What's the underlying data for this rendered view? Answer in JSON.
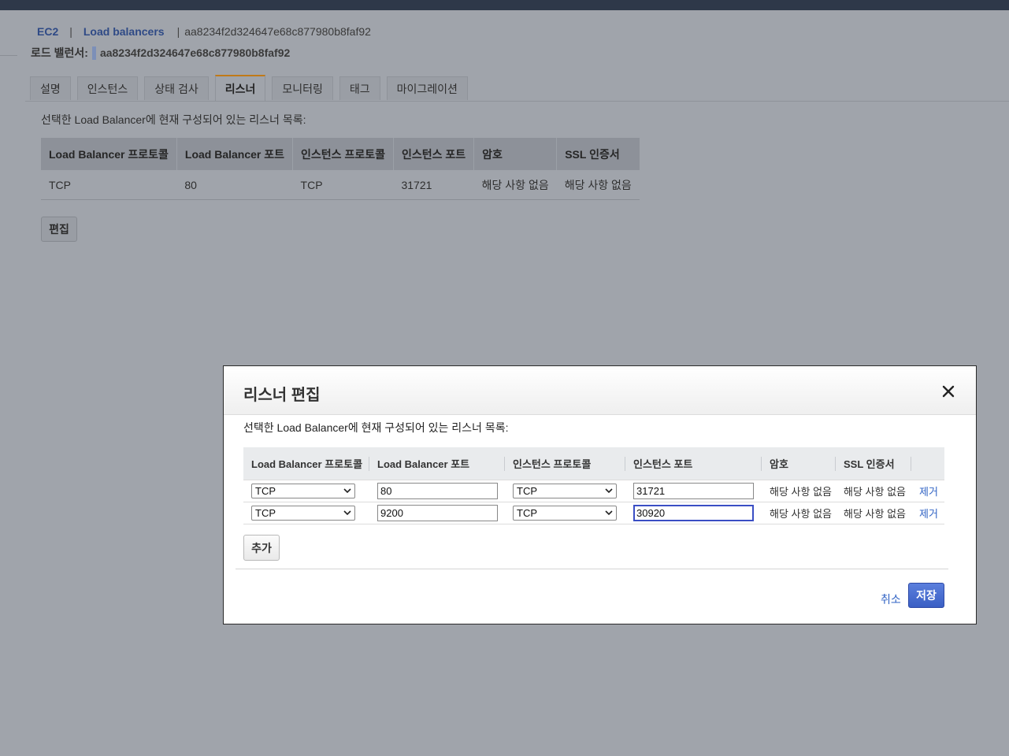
{
  "breadcrumb": {
    "ec2": "EC2",
    "separator": "|",
    "load_balancers": "Load balancers",
    "current": "aa8234f2d324647e68c877980b8faf92"
  },
  "load_balancer": {
    "label": "로드 밸런서:",
    "name": "aa8234f2d324647e68c877980b8faf92"
  },
  "tabs": [
    {
      "label": "설명",
      "active": false
    },
    {
      "label": "인스턴스",
      "active": false
    },
    {
      "label": "상태 검사",
      "active": false
    },
    {
      "label": "리스너",
      "active": true
    },
    {
      "label": "모니터링",
      "active": false
    },
    {
      "label": "태그",
      "active": false
    },
    {
      "label": "마이그레이션",
      "active": false
    }
  ],
  "listeners_panel": {
    "description": "선택한 Load Balancer에 현재 구성되어 있는 리스너 목록:",
    "headers": [
      "Load Balancer 프로토콜",
      "Load Balancer 포트",
      "인스턴스 프로토콜",
      "인스턴스 포트",
      "암호",
      "SSL 인증서"
    ],
    "rows": [
      [
        "TCP",
        "80",
        "TCP",
        "31721",
        "해당 사항 없음",
        "해당 사항 없음"
      ]
    ],
    "edit_label": "편집"
  },
  "modal": {
    "title": "리스너 편집",
    "description": "선택한 Load Balancer에 현재 구성되어 있는 리스너 목록:",
    "headers": [
      "Load Balancer 프로토콜",
      "Load Balancer 포트",
      "인스턴스 프로토콜",
      "인스턴스 포트",
      "암호",
      "SSL 인증서",
      ""
    ],
    "rows": [
      {
        "lb_protocol": "TCP",
        "lb_port": "80",
        "instance_protocol": "TCP",
        "instance_port": "31721",
        "cipher": "해당 사항 없음",
        "ssl": "해당 사항 없음",
        "remove": "제거"
      },
      {
        "lb_protocol": "TCP",
        "lb_port": "9200",
        "instance_protocol": "TCP",
        "instance_port": "30920",
        "cipher": "해당 사항 없음",
        "ssl": "해당 사항 없음",
        "remove": "제거"
      }
    ],
    "add_label": "추가",
    "cancel_label": "취소",
    "save_label": "저장"
  },
  "colors": {
    "overlay": "#a0a4ab",
    "topbar": "#2e3849",
    "link": "#2f62c4",
    "primary_button": "#3a5fc4",
    "active_tab_accent": "#c07a18",
    "focus_ring": "#3a4ec4"
  },
  "icons": {
    "close": "close-icon",
    "dropdown": "chevron-down-icon"
  }
}
